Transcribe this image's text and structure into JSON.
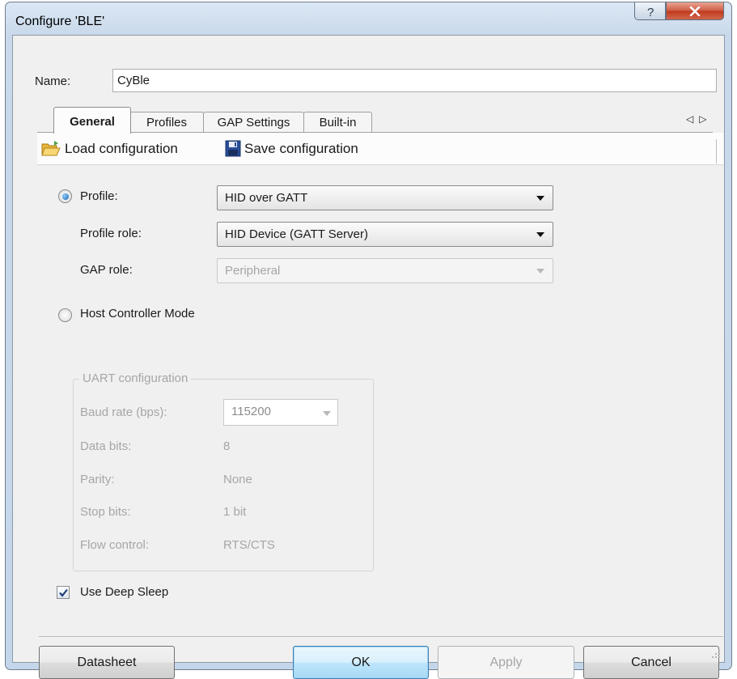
{
  "window": {
    "title": "Configure 'BLE'",
    "help_glyph": "?"
  },
  "name_row": {
    "label": "Name:",
    "value": "CyBle"
  },
  "tabs": [
    {
      "label": "General",
      "active": true
    },
    {
      "label": "Profiles",
      "active": false
    },
    {
      "label": "GAP Settings",
      "active": false
    },
    {
      "label": "Built-in",
      "active": false
    }
  ],
  "toolbar": {
    "load_label": "Load configuration",
    "save_label": "Save configuration",
    "load_icon": "folder-open-icon",
    "save_icon": "floppy-disk-icon"
  },
  "general": {
    "profile_radio_label": "Profile:",
    "profile_selected": true,
    "profile_value": "HID over GATT",
    "profile_role_label": "Profile role:",
    "profile_role_value": "HID Device (GATT Server)",
    "gap_role_label": "GAP role:",
    "gap_role_value": "Peripheral",
    "hcm_radio_label": "Host Controller Mode",
    "hcm_selected": false,
    "uart": {
      "group_title": "UART configuration",
      "baud_label": "Baud rate (bps):",
      "baud_value": "115200",
      "data_bits_label": "Data bits:",
      "data_bits_value": "8",
      "parity_label": "Parity:",
      "parity_value": "None",
      "stop_bits_label": "Stop bits:",
      "stop_bits_value": "1 bit",
      "flow_label": "Flow control:",
      "flow_value": "RTS/CTS"
    },
    "deep_sleep_label": "Use Deep Sleep",
    "deep_sleep_checked": true
  },
  "buttons": {
    "datasheet": "Datasheet",
    "ok": "OK",
    "apply": "Apply",
    "cancel": "Cancel"
  },
  "colors": {
    "accent": "#3c7fb1",
    "close": "#c0391c",
    "disabled_text": "#a6a6a6"
  }
}
